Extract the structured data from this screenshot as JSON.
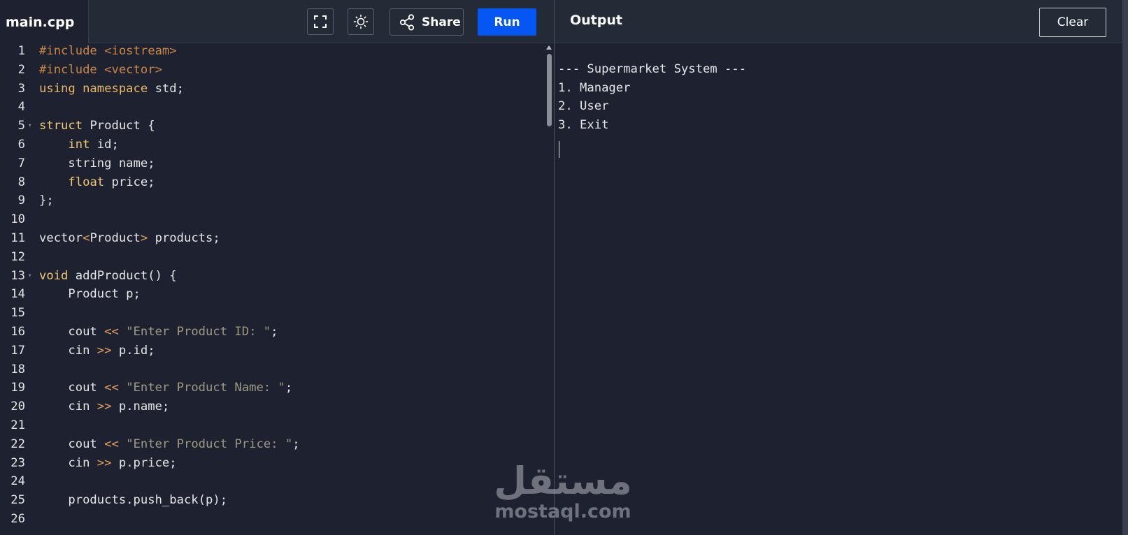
{
  "tab": {
    "filename": "main.cpp"
  },
  "toolbar": {
    "share_label": "Share",
    "run_label": "Run"
  },
  "output_panel": {
    "title": "Output",
    "clear_label": "Clear",
    "lines": [
      "",
      "--- Supermarket System ---",
      "1. Manager",
      "2. User",
      "3. Exit"
    ]
  },
  "editor": {
    "lines": [
      {
        "n": "1",
        "fold": false,
        "segs": [
          {
            "t": "#include <iostream>",
            "c": "inc"
          }
        ]
      },
      {
        "n": "2",
        "fold": false,
        "segs": [
          {
            "t": "#include <vector>",
            "c": "inc"
          }
        ]
      },
      {
        "n": "3",
        "fold": false,
        "segs": [
          {
            "t": "using namespace",
            "c": "kw-blue"
          },
          {
            "t": " std;",
            "c": ""
          }
        ]
      },
      {
        "n": "4",
        "fold": false,
        "segs": []
      },
      {
        "n": "5",
        "fold": true,
        "segs": [
          {
            "t": "struct",
            "c": "kw-purple"
          },
          {
            "t": " Product {",
            "c": ""
          }
        ]
      },
      {
        "n": "6",
        "fold": false,
        "segs": [
          {
            "t": "    ",
            "c": ""
          },
          {
            "t": "int",
            "c": "kw-purple"
          },
          {
            "t": " id;",
            "c": ""
          }
        ]
      },
      {
        "n": "7",
        "fold": false,
        "segs": [
          {
            "t": "    string name;",
            "c": ""
          }
        ]
      },
      {
        "n": "8",
        "fold": false,
        "segs": [
          {
            "t": "    ",
            "c": ""
          },
          {
            "t": "float",
            "c": "kw-purple"
          },
          {
            "t": " price;",
            "c": ""
          }
        ]
      },
      {
        "n": "9",
        "fold": false,
        "segs": [
          {
            "t": "};",
            "c": ""
          }
        ]
      },
      {
        "n": "10",
        "fold": false,
        "segs": []
      },
      {
        "n": "11",
        "fold": false,
        "segs": [
          {
            "t": "vector",
            "c": ""
          },
          {
            "t": "<",
            "c": "op"
          },
          {
            "t": "Product",
            "c": ""
          },
          {
            "t": ">",
            "c": "op"
          },
          {
            "t": " products;",
            "c": ""
          }
        ]
      },
      {
        "n": "12",
        "fold": false,
        "segs": []
      },
      {
        "n": "13",
        "fold": true,
        "segs": [
          {
            "t": "void",
            "c": "kw-purple"
          },
          {
            "t": " addProduct() {",
            "c": ""
          }
        ]
      },
      {
        "n": "14",
        "fold": false,
        "segs": [
          {
            "t": "    Product p;",
            "c": ""
          }
        ]
      },
      {
        "n": "15",
        "fold": false,
        "segs": []
      },
      {
        "n": "16",
        "fold": false,
        "segs": [
          {
            "t": "    cout ",
            "c": ""
          },
          {
            "t": "<<",
            "c": "op"
          },
          {
            "t": " \"Enter Product ID: \"",
            "c": "str"
          },
          {
            "t": ";",
            "c": ""
          }
        ]
      },
      {
        "n": "17",
        "fold": false,
        "segs": [
          {
            "t": "    cin ",
            "c": ""
          },
          {
            "t": ">>",
            "c": "op"
          },
          {
            "t": " p.id;",
            "c": ""
          }
        ]
      },
      {
        "n": "18",
        "fold": false,
        "segs": []
      },
      {
        "n": "19",
        "fold": false,
        "segs": [
          {
            "t": "    cout ",
            "c": ""
          },
          {
            "t": "<<",
            "c": "op"
          },
          {
            "t": " \"Enter Product Name: \"",
            "c": "str"
          },
          {
            "t": ";",
            "c": ""
          }
        ]
      },
      {
        "n": "20",
        "fold": false,
        "segs": [
          {
            "t": "    cin ",
            "c": ""
          },
          {
            "t": ">>",
            "c": "op"
          },
          {
            "t": " p.name;",
            "c": ""
          }
        ]
      },
      {
        "n": "21",
        "fold": false,
        "segs": []
      },
      {
        "n": "22",
        "fold": false,
        "segs": [
          {
            "t": "    cout ",
            "c": ""
          },
          {
            "t": "<<",
            "c": "op"
          },
          {
            "t": " \"Enter Product Price: \"",
            "c": "str"
          },
          {
            "t": ";",
            "c": ""
          }
        ]
      },
      {
        "n": "23",
        "fold": false,
        "segs": [
          {
            "t": "    cin ",
            "c": ""
          },
          {
            "t": ">>",
            "c": "op"
          },
          {
            "t": " p.price;",
            "c": ""
          }
        ]
      },
      {
        "n": "24",
        "fold": false,
        "segs": []
      },
      {
        "n": "25",
        "fold": false,
        "segs": [
          {
            "t": "    products.push_back(p);",
            "c": ""
          }
        ]
      },
      {
        "n": "26",
        "fold": false,
        "segs": []
      }
    ]
  },
  "watermark": {
    "arabic": "مستقل",
    "latin": "mostaql.com"
  },
  "colors": {
    "run_button": "#0556f3",
    "background": "#1d2130",
    "topbar": "#252a37"
  },
  "icons": {
    "fullscreen": "fullscreen-icon",
    "theme": "sun-icon",
    "share": "share-icon"
  }
}
